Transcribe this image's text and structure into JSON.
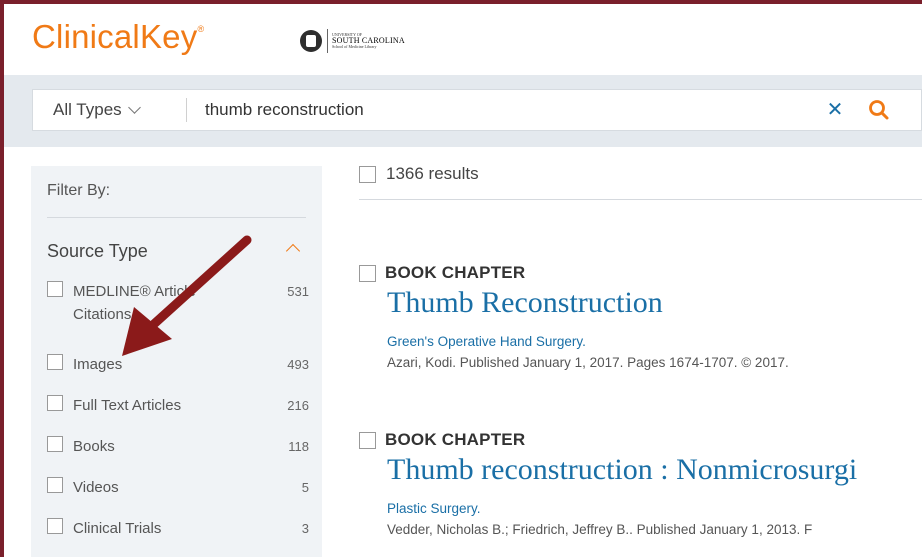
{
  "header": {
    "logo_text": "ClinicalKey",
    "logo_mark": "®",
    "institution": {
      "line1": "UNIVERSITY OF",
      "line2": "SOUTH CAROLINA",
      "line3": "School of Medicine Library"
    }
  },
  "search": {
    "type_label": "All Types",
    "query": "thumb reconstruction",
    "clear_icon": "close-icon",
    "search_icon": "search-icon"
  },
  "sidebar": {
    "filter_by": "Filter By:",
    "section_title": "Source Type",
    "facets": [
      {
        "label": "MEDLINE® Article Citations",
        "count": "531"
      },
      {
        "label": "Images",
        "count": "493"
      },
      {
        "label": "Full Text Articles",
        "count": "216"
      },
      {
        "label": "Books",
        "count": "118"
      },
      {
        "label": "Videos",
        "count": "5"
      },
      {
        "label": "Clinical Trials",
        "count": "3"
      }
    ]
  },
  "results": {
    "count_text": "1366 results",
    "items": [
      {
        "type": "BOOK CHAPTER",
        "title": "Thumb Reconstruction",
        "source": "Green's Operative Hand Surgery.",
        "meta": "Azari, Kodi. Published January 1, 2017. Pages 1674-1707. © 2017."
      },
      {
        "type": "BOOK CHAPTER",
        "title": "Thumb reconstruction : Nonmicrosurgi",
        "source": "Plastic Surgery.",
        "meta": "Vedder, Nicholas B.; Friedrich, Jeffrey B.. Published January 1, 2013. F"
      }
    ]
  },
  "colors": {
    "brand_orange": "#f07a16",
    "link_blue": "#1a6fa6",
    "frame_maroon": "#7a1f2b",
    "annotation_arrow": "#8b1a1a"
  }
}
